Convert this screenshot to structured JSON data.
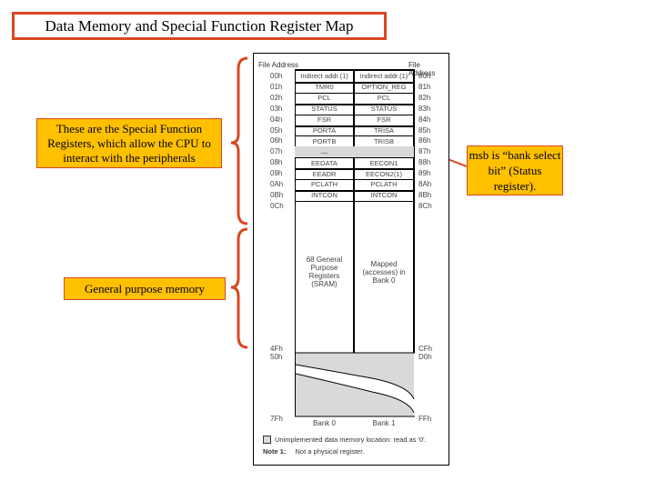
{
  "title": "Data Memory and Special Function Register Map",
  "callouts": {
    "sfr": "These are the Special Function Registers, which allow the CPU to interact with the peripherals",
    "general": "General purpose memory",
    "msb": "msb is “bank select bit” (Status register)."
  },
  "colors": {
    "accent": "#d9481f",
    "callout_fill": "#ffc000",
    "unimplemented": "#d9d9d9"
  },
  "map": {
    "header_left": "File Address",
    "header_right": "File Address",
    "rows": [
      {
        "addr0": "00h",
        "bank0": "Indirect addr.(1)",
        "bank1": "Indirect addr.(1)",
        "addr1": "80h"
      },
      {
        "addr0": "01h",
        "bank0": "TMR0",
        "bank1": "OPTION_REG",
        "addr1": "81h"
      },
      {
        "addr0": "02h",
        "bank0": "PCL",
        "bank1": "PCL",
        "addr1": "82h"
      },
      {
        "addr0": "03h",
        "bank0": "STATUS",
        "bank1": "STATUS",
        "addr1": "83h"
      },
      {
        "addr0": "04h",
        "bank0": "FSR",
        "bank1": "FSR",
        "addr1": "84h"
      },
      {
        "addr0": "05h",
        "bank0": "PORTA",
        "bank1": "TRISA",
        "addr1": "85h"
      },
      {
        "addr0": "06h",
        "bank0": "PORTB",
        "bank1": "TRISB",
        "addr1": "86h"
      },
      {
        "addr0": "07h",
        "bank0": "—",
        "bank1": "",
        "addr1": "87h"
      },
      {
        "addr0": "08h",
        "bank0": "EEDATA",
        "bank1": "EECON1",
        "addr1": "88h"
      },
      {
        "addr0": "09h",
        "bank0": "EEADR",
        "bank1": "EECON2(1)",
        "addr1": "89h"
      },
      {
        "addr0": "0Ah",
        "bank0": "PCLATH",
        "bank1": "PCLATH",
        "addr1": "8Ah"
      },
      {
        "addr0": "0Bh",
        "bank0": "INTCON",
        "bank1": "INTCON",
        "addr1": "8Bh"
      },
      {
        "addr0": "0Ch",
        "bank0": "",
        "bank1": "",
        "addr1": "8Ch"
      }
    ],
    "gpr_text": "68 General Purpose Registers (SRAM)",
    "mapped_text": "Mapped (accesses) in Bank 0",
    "addr_4fh": "4Fh",
    "addr_50h": "50h",
    "addr_cfh": "CFh",
    "addr_d0h": "D0h",
    "addr_7fh": "7Fh",
    "addr_ffh": "FFh",
    "bank0_label": "Bank 0",
    "bank1_label": "Bank 1",
    "legend_text": "Unimplemented data memory location: read as '0'.",
    "note_label": "Note 1:",
    "note_text": "Not a physical register."
  }
}
